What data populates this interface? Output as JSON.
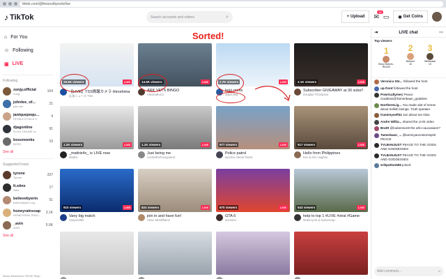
{
  "browser": {
    "url": "tiktok.com/@thesouthpoolx/live"
  },
  "header": {
    "logo": "TikTok",
    "search_placeholder": "Search accounts and videos",
    "upload_label": "Upload",
    "inbox_badge": "60",
    "coins_label": "Get Coins"
  },
  "sidebar": {
    "nav": [
      {
        "label": "For You",
        "icon": "home-icon"
      },
      {
        "label": "Following",
        "icon": "following-icon"
      },
      {
        "label": "LIVE",
        "icon": "live-icon"
      }
    ],
    "following_title": "Following",
    "following": [
      {
        "name": "zonjy.official",
        "sub": "Zonjy",
        "count": "164",
        "color": "#7b5a3c"
      },
      {
        "name": "johnlee_of...",
        "sub": "john lee",
        "count": "21",
        "color": "#3f6fa8"
      },
      {
        "name": "janiquepequ...",
        "sub": "PETALE ETOILE 5",
        "count": "4",
        "color": "#c9a38a"
      },
      {
        "name": "djagonline",
        "sub": "DJ AG ONLINE xx",
        "count": "91",
        "color": "#30343a"
      },
      {
        "name": "bossmonks",
        "sub": "BOSS",
        "count": "19",
        "color": "#6a6a6a"
      }
    ],
    "see_all_1": "See all",
    "suggested_title": "Suggested hosts",
    "suggested": [
      {
        "name": "tyrone",
        "sub": "Tyrone",
        "count": "337",
        "color": "#5a3a2a"
      },
      {
        "name": "lt.stinx",
        "sub": "Stinx",
        "count": "17",
        "color": "#2d2d2d"
      },
      {
        "name": "believebyerin",
        "sub": "believebyerin cop...",
        "count": "51",
        "color": "#b38a72"
      },
      {
        "name": "honeyrainsoap",
        "sub": "HONEYRAIN TRAD...",
        "count": "3.1K",
        "color": "#d9b07a"
      },
      {
        "name": "_avin",
        "sub": "AVIN",
        "count": "5.0K",
        "color": "#8a6a55"
      }
    ],
    "see_all_2": "See all",
    "footer": "About  Newsroom  TikTok Shop"
  },
  "main": {
    "annotation": "Sorted!",
    "cards": [
      {
        "title": "【LIVE】TSS情報カメラ Hiroshima",
        "host": "広島ニュース TSS",
        "viewers": "29.5K viewers",
        "bg": "linear-gradient(180deg,#f3f3f3,#d6e4f2)",
        "avc": "#1a4fa0"
      },
      {
        "title": "ARK VETS BINGO",
        "host": "Alexandrucci",
        "viewers": "14.5K viewers",
        "bg": "linear-gradient(180deg,#6a7f91,#44525e)",
        "avc": "#4e3b2e"
      },
      {
        "title": "lego prints",
        "host": "3dprinting",
        "viewers": "2.7K viewers",
        "bg": "linear-gradient(180deg,#bcd9f2,#eef5fb)",
        "avc": "#2a5aa0"
      },
      {
        "title": "Subscriber GIVEAWAY at 30 subs!!",
        "host": "Douglas Thompson",
        "viewers": "2.1K viewers",
        "bg": "linear-gradient(180deg,#1c1c1c,#3a2f2a)",
        "avc": "#6b4a3a"
      },
      {
        "title": "_mattrix4x_ is LIVE now",
        "host": "Mattrix",
        "viewers": "1.2K viewers",
        "bg": "linear-gradient(180deg,#e8e8e8,#9a9a9a)",
        "avc": "#222"
      },
      {
        "title": "Just being me",
        "host": "Cooleirthefunnyparrot",
        "viewers": "1.1K viewers",
        "bg": "linear-gradient(180deg,#c9c9c9,#7a7a7a)",
        "avc": "#888"
      },
      {
        "title": "Police patrol",
        "host": "Buzztex Street Patrol",
        "viewers": "977 viewers",
        "bg": "linear-gradient(180deg,#7aa2c8,#b68f7c)",
        "avc": "#445"
      },
      {
        "title": "Hello from Philippines",
        "host": "Kev & Kim Hughes",
        "viewers": "917 viewers",
        "bg": "linear-gradient(180deg,#a89278,#5a4a3c)",
        "avc": "#8a6a55"
      },
      {
        "title": "Vany big match",
        "host": "Vanyworlds",
        "viewers": "910 viewers",
        "bg": "linear-gradient(180deg,#2a6bc9,#0b2c6e)",
        "avc": "#1c3e8a"
      },
      {
        "title": "join in and have fun!",
        "host": "Vince McWilliams",
        "viewers": "824 viewers",
        "bg": "linear-gradient(180deg,#d8cfc4,#9b8b7a)",
        "avc": "#b08a6a"
      },
      {
        "title": "GTA 6",
        "host": "sunnami",
        "viewers": "670 viewers",
        "bg": "linear-gradient(180deg,#7a3fa0,#e0452e)",
        "avc": "#3a2a2a"
      },
      {
        "title": "help to top 1 #LIVE #viral #Game",
        "host": "Motorcycle & Gamescap",
        "viewers": "643 viewers",
        "bg": "linear-gradient(180deg,#b8c8d8,#5a6a4a)",
        "avc": "#333"
      },
      {
        "title": "",
        "host": "",
        "viewers": "",
        "bg": "linear-gradient(180deg,#e8e8e8,#c8c8c8)",
        "avc": "#999"
      },
      {
        "title": "",
        "host": "",
        "viewers": "",
        "bg": "linear-gradient(180deg,#d8dde3,#9aa3ad)",
        "avc": "#999"
      },
      {
        "title": "",
        "host": "",
        "viewers": "",
        "bg": "linear-gradient(180deg,#d6c8e0,#8a7aa0)",
        "avc": "#999"
      },
      {
        "title": "",
        "host": "",
        "viewers": "",
        "bg": "linear-gradient(180deg,#c94040,#7a2020)",
        "avc": "#999"
      }
    ]
  },
  "chat": {
    "title": "LIVE chat",
    "top_viewers_label": "Top viewers",
    "top": [
      {
        "rank": "1",
        "name": "Erica Dickers..",
        "pts": "Rtx433",
        "color": "#c98a6a"
      },
      {
        "rank": "2",
        "name": "Beirnee",
        "pts": "10",
        "color": "#d9a07a"
      },
      {
        "rank": "3",
        "name": "Whiteskull",
        "pts": "10",
        "color": "#5a4a3a"
      }
    ],
    "messages": [
      {
        "user": "Veronica Ste...",
        "text": "followed the host",
        "color": "#b06a4a"
      },
      {
        "user": "up-front",
        "text": "followed the host",
        "color": "#4a6ab0"
      },
      {
        "user": "Powricaltyme1",
        "text": "Peace Goddess@Tamerikaan_goddess",
        "color": "#333"
      },
      {
        "user": "NorthernLig...",
        "text": "You made alot of sense about hellish beings. Truth speaker",
        "color": "#6a8a4a"
      },
      {
        "user": "true2myself41",
        "text": "sun about too slow",
        "color": "#8a5a3a"
      },
      {
        "user": "Andre Willia...",
        "text": "shared the LIVE video",
        "color": "#444"
      },
      {
        "user": "Brattt",
        "text": "@loubenson9 the afro-caucasians?",
        "color": "#a04a6a"
      },
      {
        "user": "Tamerkaan_...",
        "text": "@iammyancestorsspirit PEACE",
        "color": "#6a4a8a"
      },
      {
        "user": "TVLBANJUST",
        "text": "PEACE TO THE GODS AND GODDESSES",
        "color": "#2a2a2a"
      },
      {
        "user": "TVLBANJUST",
        "text": "PEACE TO THE GODS AND GODDESSES",
        "color": "#2a2a2a"
      },
      {
        "user": "erikpatton555",
        "text": "joined",
        "color": "#5a7a9a"
      }
    ],
    "input_placeholder": "Add comment..."
  }
}
